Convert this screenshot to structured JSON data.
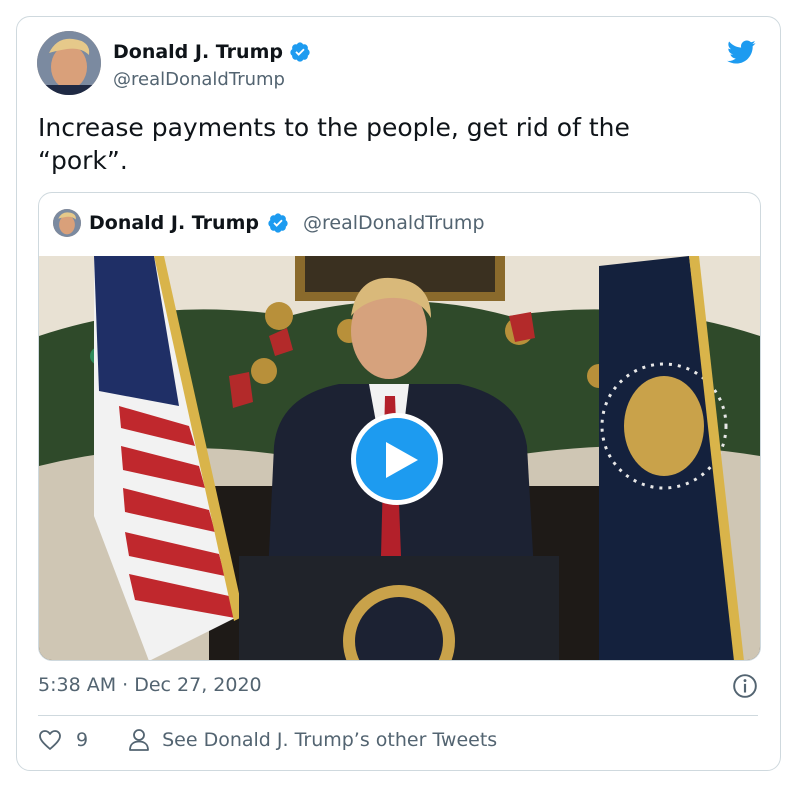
{
  "author": {
    "name": "Donald J. Trump",
    "handle": "@realDonaldTrump",
    "verified": true
  },
  "tweet": {
    "text": "Increase payments to the people, get rid of the\n“pork”.",
    "timestamp": "5:38 AM · Dec 27, 2020"
  },
  "quoted_tweet": {
    "name": "Donald J. Trump",
    "handle": "@realDonaldTrump",
    "media_type": "video"
  },
  "actions": {
    "like_count": "9",
    "other_tweets_label": "See Donald J. Trump’s other Tweets"
  },
  "colors": {
    "accent": "#1d9bf0",
    "secondary_text": "#536471",
    "border": "#cfd9de"
  },
  "icons": [
    "twitter-bird-icon",
    "verified-badge-icon",
    "play-icon",
    "info-icon",
    "heart-icon",
    "person-icon"
  ]
}
